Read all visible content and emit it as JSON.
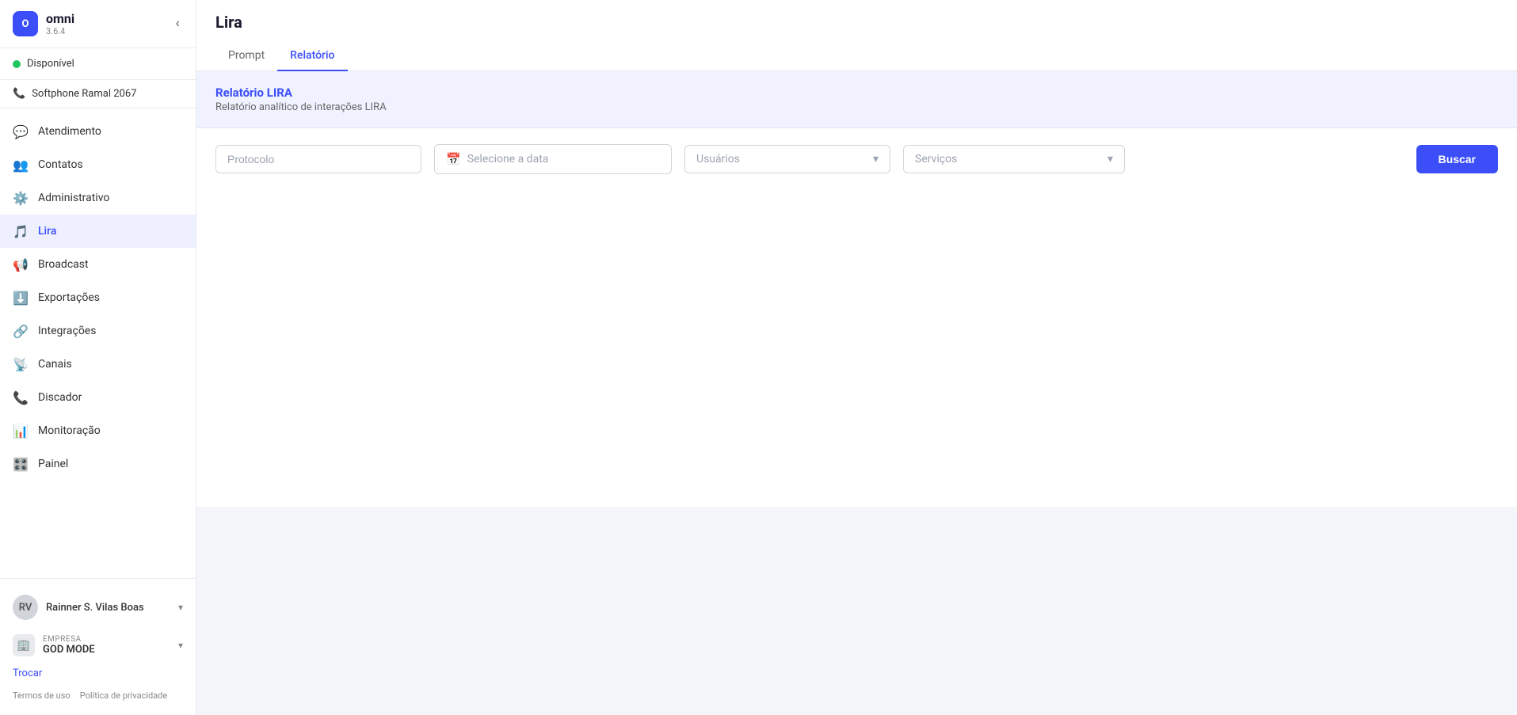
{
  "app": {
    "name": "omni",
    "version": "3.6.4",
    "logo_letter": "O"
  },
  "sidebar": {
    "status": {
      "label": "Disponível",
      "color": "#22c55e"
    },
    "softphone": {
      "label": "Softphone Ramal 2067"
    },
    "nav_items": [
      {
        "id": "atendimento",
        "label": "Atendimento",
        "icon": "💬",
        "active": false
      },
      {
        "id": "contatos",
        "label": "Contatos",
        "icon": "👥",
        "active": false
      },
      {
        "id": "administrativo",
        "label": "Administrativo",
        "icon": "⚙️",
        "active": false
      },
      {
        "id": "lira",
        "label": "Lira",
        "icon": "🎵",
        "active": true
      },
      {
        "id": "broadcast",
        "label": "Broadcast",
        "icon": "📢",
        "active": false
      },
      {
        "id": "exportacoes",
        "label": "Exportações",
        "icon": "⬇️",
        "active": false
      },
      {
        "id": "integracoes",
        "label": "Integrações",
        "icon": "🔗",
        "active": false
      },
      {
        "id": "canais",
        "label": "Canais",
        "icon": "📡",
        "active": false
      },
      {
        "id": "discador",
        "label": "Discador",
        "icon": "📞",
        "active": false
      },
      {
        "id": "monitoracao",
        "label": "Monitoração",
        "icon": "📊",
        "active": false
      },
      {
        "id": "painel",
        "label": "Painel",
        "icon": "🎛️",
        "active": false
      }
    ],
    "user": {
      "name": "Rainner S. Vilas Boas",
      "initials": "RV"
    },
    "company": {
      "label": "EMPRESA",
      "name": "GOD MODE"
    },
    "trocar": "Trocar",
    "footer_links": [
      "Termos de uso",
      "Política de privacidade"
    ]
  },
  "page": {
    "title": "Lira",
    "tabs": [
      {
        "id": "prompt",
        "label": "Prompt",
        "active": false
      },
      {
        "id": "relatorio",
        "label": "Relatório",
        "active": true
      }
    ]
  },
  "report": {
    "title": "Relatório LIRA",
    "subtitle": "Relatório analítico de interações LIRA",
    "filters": {
      "protocolo_placeholder": "Protocolo",
      "date_placeholder": "Selecione a data",
      "usuarios_placeholder": "Usuários",
      "servicos_placeholder": "Serviços"
    },
    "buscar_label": "Buscar"
  }
}
